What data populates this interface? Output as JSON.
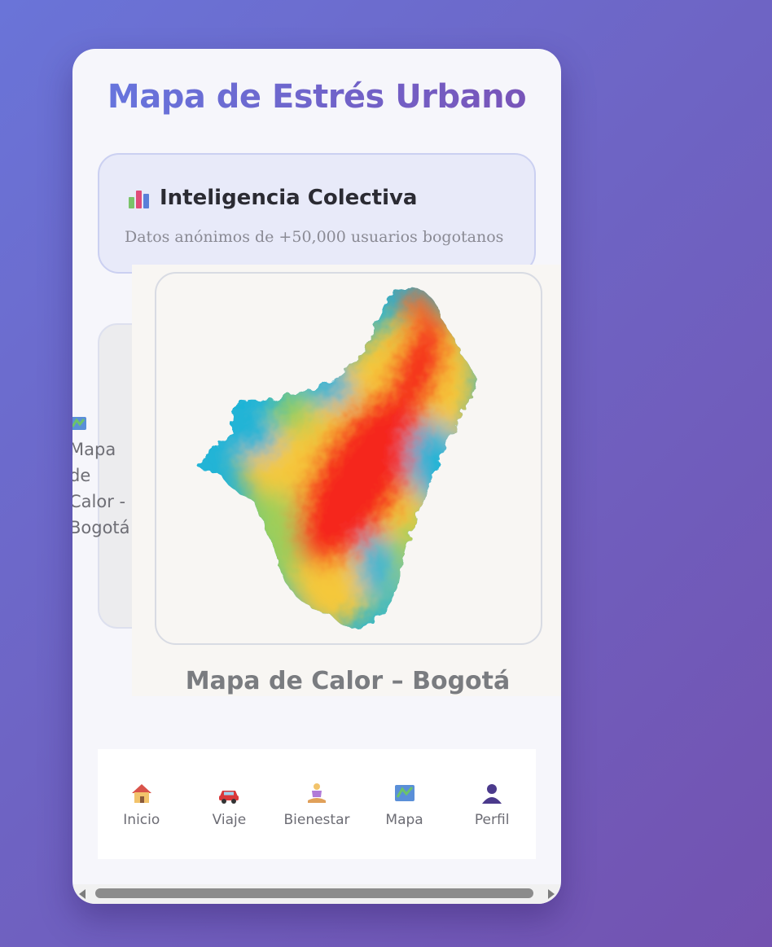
{
  "header": {
    "title": "Mapa de Estrés Urbano"
  },
  "intelligence_card": {
    "icon": "bar-chart-icon",
    "title": "Inteligencia Colectiva",
    "subtitle": "Datos anónimos de +50,000 usuarios bogotanos"
  },
  "background_card": {
    "icon": "map-icon",
    "label": "Mapa de Calor - Bogotá"
  },
  "heatmap": {
    "icon": "heatmap-map-icon",
    "caption": "Mapa de Calor – Bogotá"
  },
  "nav": {
    "items": [
      {
        "label": "Inicio",
        "icon": "house-icon"
      },
      {
        "label": "Viaje",
        "icon": "car-icon"
      },
      {
        "label": "Bienestar",
        "icon": "meditation-icon"
      },
      {
        "label": "Mapa",
        "icon": "map-icon"
      },
      {
        "label": "Perfil",
        "icon": "person-icon"
      }
    ]
  },
  "colors": {
    "title_gradient_start": "#6577e0",
    "title_gradient_end": "#7a52b6",
    "heat_high": "#f5281e",
    "heat_mid": "#f5c83a",
    "heat_low": "#22b4d6"
  }
}
